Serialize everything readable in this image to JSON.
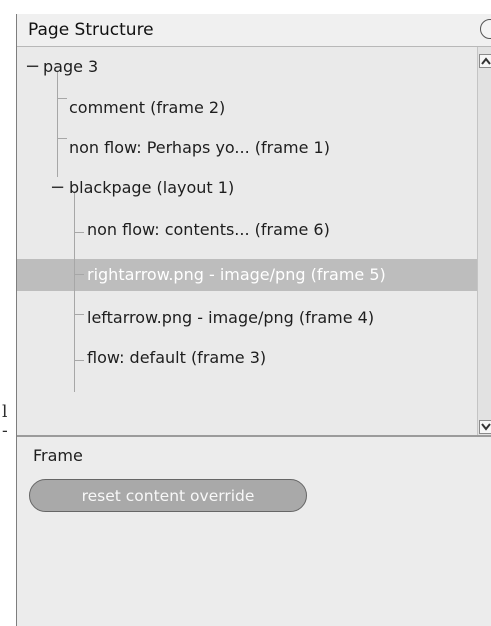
{
  "left_strip": {
    "chars": [
      "l",
      "-"
    ]
  },
  "panel": {
    "title": "Page Structure",
    "close_icon": "circle-close-icon"
  },
  "tree": {
    "nodes": [
      {
        "label": "page 3",
        "toggle": "−",
        "depth": 0
      },
      {
        "label": "comment (frame 2)",
        "depth": 1
      },
      {
        "label": "non flow: Perhaps yo... (frame 1)",
        "depth": 1
      },
      {
        "label": "blackpage (layout 1)",
        "toggle": "−",
        "depth": 1
      },
      {
        "label": "non flow: contents... (frame 6)",
        "depth": 2
      },
      {
        "label": "rightarrow.png - image/png (frame 5)",
        "depth": 2,
        "selected": true
      },
      {
        "label": "leftarrow.png - image/png (frame 4)",
        "depth": 2
      },
      {
        "label": "flow: default (frame 3)",
        "depth": 2
      }
    ],
    "scroll_up_icon": "chevron-up-icon",
    "scroll_down_icon": "chevron-down-icon"
  },
  "frame_section": {
    "label": "Frame",
    "reset_button": "reset content override"
  },
  "colors": {
    "selection": "#bdbdbd",
    "panel_bg": "#ececec",
    "button_bg": "#a9a9a9"
  }
}
